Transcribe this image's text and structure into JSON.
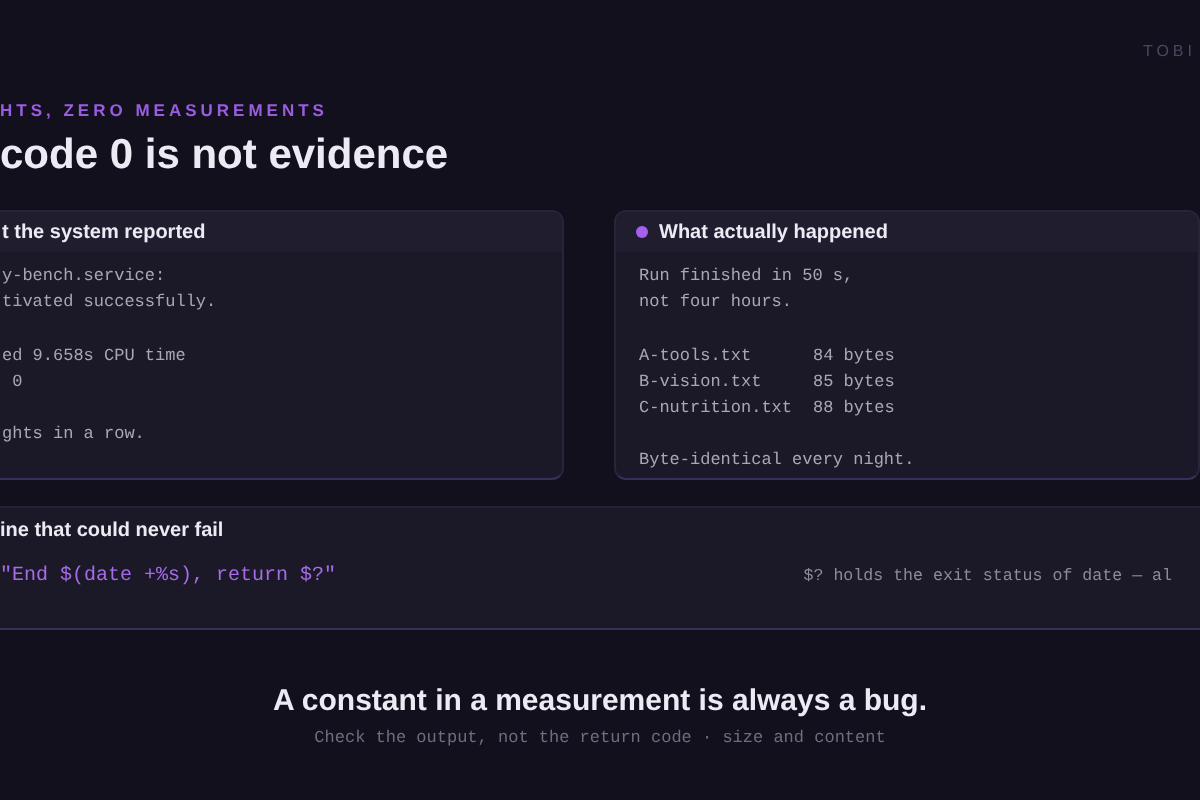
{
  "brand": "TOBI",
  "eyebrow": "HTS, ZERO MEASUREMENTS",
  "title": "code 0 is not evidence",
  "cards": [
    {
      "title": "t the system reported",
      "groups": [
        [
          "y-bench.service:",
          "tivated successfully."
        ],
        [
          "ed 9.658s CPU time",
          " 0"
        ],
        [
          "ghts in a row."
        ]
      ]
    },
    {
      "title": "What actually happened",
      "intro": [
        "Run finished in 50 s,",
        "not four hours."
      ],
      "files": [
        {
          "name": "A-tools.txt",
          "size": "84 bytes"
        },
        {
          "name": "B-vision.txt",
          "size": "85 bytes"
        },
        {
          "name": "C-nutrition.txt",
          "size": "88 bytes"
        }
      ],
      "outro": [
        "Byte-identical every night."
      ]
    }
  ],
  "code_card": {
    "title": "ine that could never fail",
    "code": "\"End $(date +%s), return $?\"",
    "note": "$? holds the exit status of date — al"
  },
  "footer": {
    "headline": "A constant in a measurement is always a bug.",
    "subline": "Check the output, not the return code · size and content"
  }
}
